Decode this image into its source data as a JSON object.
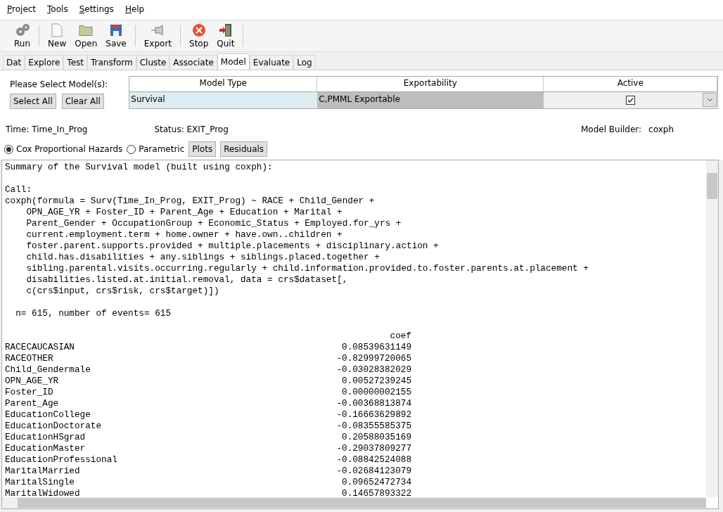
{
  "menu": [
    "Project",
    "Tools",
    "Settings",
    "Help"
  ],
  "toolbar": [
    {
      "kind": "run",
      "label": "Run"
    },
    {
      "kind": "new",
      "label": "New"
    },
    {
      "kind": "open",
      "label": "Open"
    },
    {
      "kind": "save",
      "label": "Save"
    },
    {
      "kind": "export",
      "label": "Export"
    },
    {
      "kind": "stop",
      "label": "Stop"
    },
    {
      "kind": "quit",
      "label": "Quit"
    }
  ],
  "tabs": [
    {
      "label": "Dat",
      "selected": false
    },
    {
      "label": "Explore",
      "selected": false
    },
    {
      "label": "Test",
      "selected": false
    },
    {
      "label": "Transform",
      "selected": false
    },
    {
      "label": "Cluste",
      "selected": false
    },
    {
      "label": "Associate",
      "selected": false
    },
    {
      "label": "Model",
      "selected": true
    },
    {
      "label": "Evaluate",
      "selected": false
    },
    {
      "label": "Log",
      "selected": false
    }
  ],
  "model_panel": {
    "prompt": "Please Select Model(s):",
    "buttons": [
      "Select All",
      "Clear All"
    ],
    "table": {
      "columns": [
        "Model Type",
        "Exportability",
        "Active"
      ],
      "rows": [
        {
          "model_type": "Survival",
          "exportability": "C,PMML Exportable",
          "active": true
        }
      ]
    },
    "time": "Time: Time_In_Prog",
    "status": "Status: EXIT_Prog",
    "builder_label": "Model Builder:",
    "builder_value": "coxph",
    "options": [
      {
        "label": "Cox Proportional Hazards",
        "selected": true
      },
      {
        "label": "Parametric",
        "selected": false
      }
    ],
    "actions": [
      "Plots",
      "Residuals"
    ]
  },
  "output": {
    "title": "Summary of the Survival model (built using coxph):",
    "call_label": "Call:",
    "call_lines": [
      "coxph(formula = Surv(Time_In_Prog, EXIT_Prog) ~ RACE + Child_Gender +",
      "    OPN_AGE_YR + Foster_ID + Parent_Age + Education + Marital +",
      "    Parent_Gender + OccupationGroup + Economic_Status + Employed.for_yrs +",
      "    current.employment.term + home.owner + have.own..children +",
      "    foster.parent.supports.provided + multiple.placements + disciplinary.action +",
      "    child.has.disabilities + any.siblings + siblings.placed.together +",
      "    sibling.parental.visits.occurring.regularly + child.information.provided.to.foster.parents.at.placement +",
      "    disabilities.listed.at.initial.removal, data = crs$dataset[,",
      "    c(crs$input, crs$risk, crs$target)])"
    ],
    "events": "  n= 615, number of events= 615",
    "coef_header": "coef",
    "coefs": [
      {
        "name": "RACECAUCASIAN",
        "coef": "0.08539631149"
      },
      {
        "name": "RACEOTHER",
        "coef": "-0.82999720065"
      },
      {
        "name": "Child_Gendermale",
        "coef": "-0.03028382029"
      },
      {
        "name": "OPN_AGE_YR",
        "coef": "0.00527239245"
      },
      {
        "name": "Foster_ID",
        "coef": "0.00000002155"
      },
      {
        "name": "Parent_Age",
        "coef": "-0.00368813874"
      },
      {
        "name": "EducationCollege",
        "coef": "-0.16663629892"
      },
      {
        "name": "EducationDoctorate",
        "coef": "-0.08355585375"
      },
      {
        "name": "EducationHSgrad",
        "coef": "0.20588035169"
      },
      {
        "name": "EducationMaster",
        "coef": "-0.29037809277"
      },
      {
        "name": "EducationProfessional",
        "coef": "-0.08842524088"
      },
      {
        "name": "MaritalMarried",
        "coef": "-0.02684123079"
      },
      {
        "name": "MaritalSingle",
        "coef": "0.09652472734"
      },
      {
        "name": "MaritalWidowed",
        "coef": "0.14657893322"
      }
    ]
  }
}
